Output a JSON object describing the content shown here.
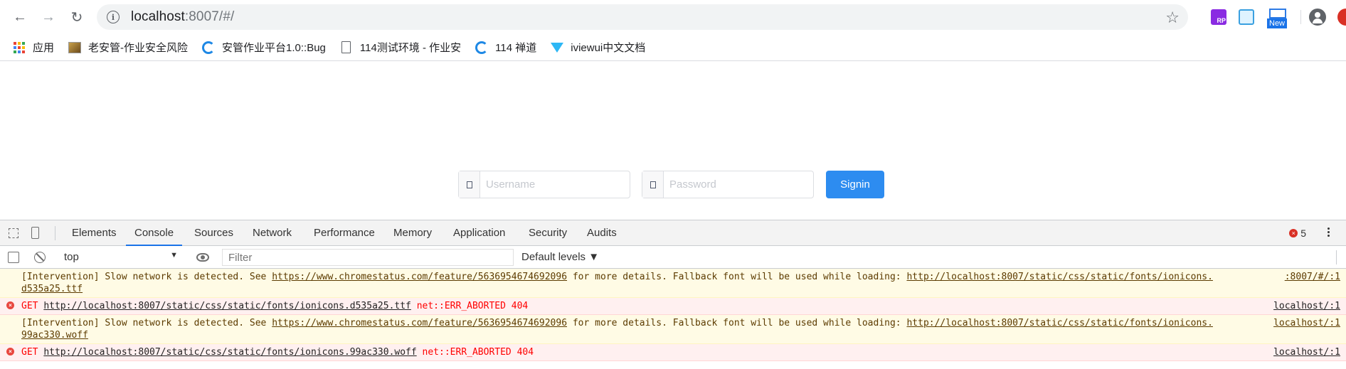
{
  "browser": {
    "url_host": "localhost",
    "url_rest": ":8007/#/",
    "ext_rp_label": "RP",
    "ext_new_label": "New"
  },
  "bookmarks": [
    {
      "label": "应用",
      "icon": "apps-grid-icon"
    },
    {
      "label": "老安管-作业安全风险",
      "icon": "image-icon"
    },
    {
      "label": "安管作业平台1.0::Bug",
      "icon": "chandao-icon"
    },
    {
      "label": "114测试环境 - 作业安",
      "icon": "document-icon"
    },
    {
      "label": "114 禅道",
      "icon": "chandao-icon"
    },
    {
      "label": "iviewui中文文档",
      "icon": "iview-icon"
    }
  ],
  "login": {
    "username_placeholder": "Username",
    "password_placeholder": "Password",
    "signin_label": "Signin"
  },
  "devtools": {
    "tabs": [
      "Elements",
      "Console",
      "Sources",
      "Network",
      "Performance",
      "Memory",
      "Application",
      "Security",
      "Audits"
    ],
    "active_tab": "Console",
    "error_count": "5",
    "context": "top",
    "filter_placeholder": "Filter",
    "levels": "Default levels ▼"
  },
  "console": {
    "warn1": {
      "text": "[Intervention] Slow network is detected. See ",
      "link": "https://www.chromestatus.com/feature/5636954674692096",
      "mid": " for more details. Fallback font will be used while loading: ",
      "url": "http://localhost:8007/static/css/static/fonts/ionicons.",
      "cont": "d535a25.ttf",
      "src": ":8007/#/:1"
    },
    "err1": {
      "method": "GET ",
      "url": "http://localhost:8007/static/css/static/fonts/ionicons.d535a25.ttf",
      "status": " net::ERR_ABORTED 404",
      "src": "localhost/:1"
    },
    "warn2": {
      "text": "[Intervention] Slow network is detected. See ",
      "link": "https://www.chromestatus.com/feature/5636954674692096",
      "mid": " for more details. Fallback font will be used while loading: ",
      "url": "http://localhost:8007/static/css/static/fonts/ionicons.",
      "cont": "99ac330.woff",
      "src": "localhost/:1"
    },
    "err2": {
      "method": "GET ",
      "url": "http://localhost:8007/static/css/static/fonts/ionicons.99ac330.woff",
      "status": " net::ERR_ABORTED 404",
      "src": "localhost/:1"
    }
  }
}
